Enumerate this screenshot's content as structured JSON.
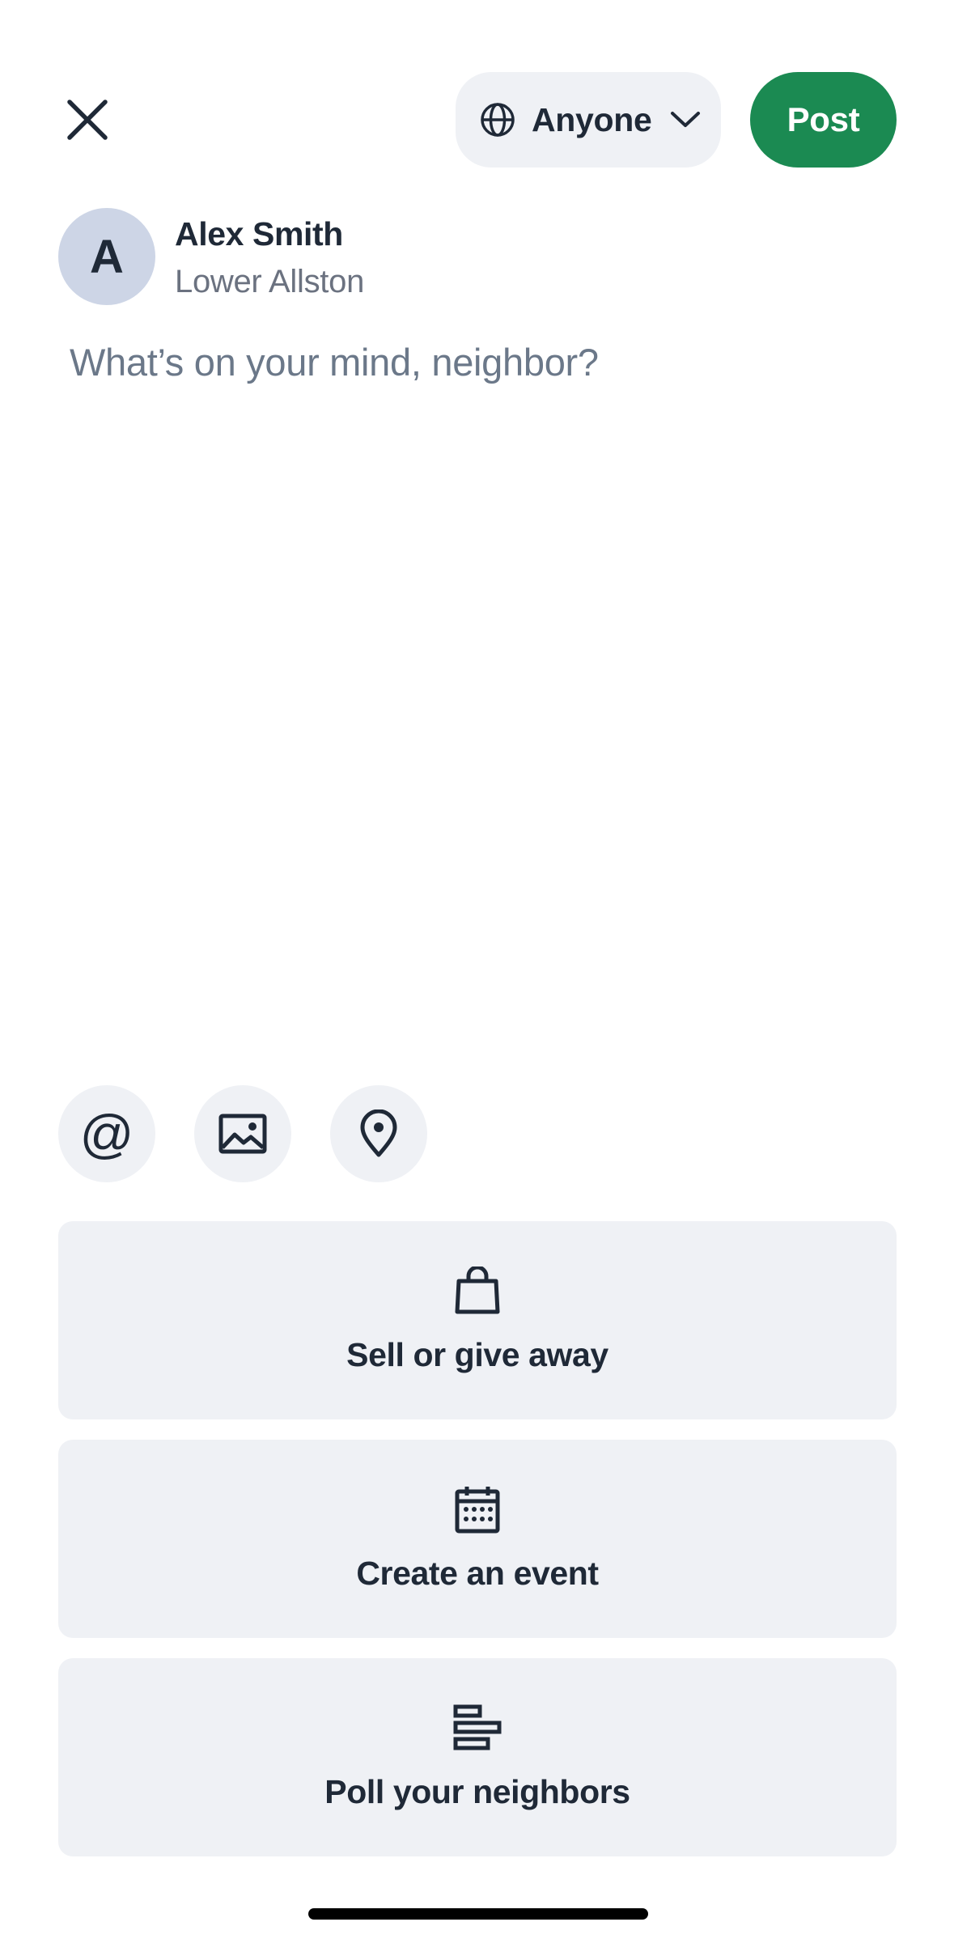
{
  "header": {
    "close_icon": "close-icon",
    "audience": {
      "icon": "globe-icon",
      "label": "Anyone",
      "chevron": "chevron-down-icon"
    },
    "post_label": "Post",
    "post_color": "#1b8a52"
  },
  "author": {
    "avatar_initial": "A",
    "avatar_color": "#cdd5e6",
    "name": "Alex Smith",
    "location": "Lower Allston"
  },
  "composer": {
    "placeholder": "What’s on your mind, neighbor?",
    "value": ""
  },
  "tools": [
    {
      "icon": "mention-icon"
    },
    {
      "icon": "photo-icon"
    },
    {
      "icon": "location-pin-icon"
    }
  ],
  "actions": [
    {
      "icon": "shopping-bag-icon",
      "label": "Sell or give away"
    },
    {
      "icon": "calendar-icon",
      "label": "Create an event"
    },
    {
      "icon": "poll-icon",
      "label": "Poll your neighbors"
    }
  ]
}
